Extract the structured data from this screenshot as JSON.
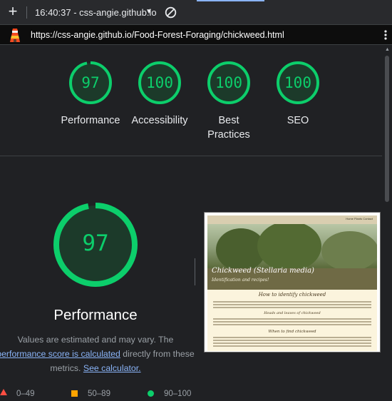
{
  "toolbar": {
    "new_tab": "+",
    "tab_title": "16:40:37 - css-angie.github.io",
    "dropdown_caret": "▼",
    "block_icon": "block-icon"
  },
  "address": {
    "url": "https://css-angie.github.io/Food-Forest-Foraging/chickweed.html",
    "logo_icon": "lighthouse-icon",
    "menu_icon": "kebab-menu-icon"
  },
  "scores": [
    {
      "label": "Performance",
      "value": "97",
      "fraction": 0.97
    },
    {
      "label": "Accessibility",
      "value": "100",
      "fraction": 1.0
    },
    {
      "label": "Best Practices",
      "label_line1": "Best",
      "label_line2": "Practices",
      "value": "100",
      "fraction": 1.0
    },
    {
      "label": "SEO",
      "value": "100",
      "fraction": 1.0
    }
  ],
  "performance": {
    "value": "97",
    "fraction": 0.97,
    "title": "Performance",
    "desc_part1": "Values are estimated and may vary. The",
    "desc_link1": "performance score is calculated",
    "desc_part2": "directly from these",
    "desc_part3": "metrics.",
    "desc_link2": "See calculator."
  },
  "thumbnail": {
    "nav_links": "Home  Plants  Contact",
    "hero_title": "Chickweed (Stellaria media)",
    "hero_subtitle": "Identification and recipes!",
    "heading1": "How to identify chickweed",
    "heading2": "Heads and leaves of chickweed",
    "heading3": "When to find chickweed"
  },
  "legend": [
    {
      "range": "0–49",
      "color": "#ff4e42"
    },
    {
      "range": "50–89",
      "color": "#ffa400"
    },
    {
      "range": "90–100",
      "color": "#0cce6b"
    }
  ],
  "colors": {
    "pass": "#0cce6b",
    "average": "#ffa400",
    "fail": "#ff4e42",
    "link": "#8ab4f8",
    "background": "#202124"
  }
}
